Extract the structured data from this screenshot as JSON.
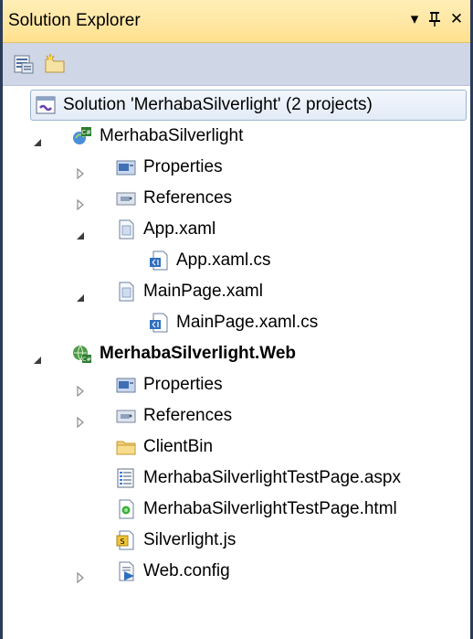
{
  "panel": {
    "title": "Solution Explorer",
    "controls": {
      "dropdown": "▾",
      "pin": "ᛘ",
      "close": "✕"
    }
  },
  "toolbar": {
    "buttons": [
      {
        "name": "properties-icon"
      },
      {
        "name": "show-all-files-icon"
      }
    ]
  },
  "tree": {
    "solution": "Solution 'MerhabaSilverlight' (2 projects)",
    "items": [
      {
        "label": "MerhabaSilverlight",
        "icon": "csharp-silverlight-project-icon",
        "expander": "expanded"
      },
      {
        "label": "Properties",
        "icon": "properties-folder-icon",
        "expander": "collapsed"
      },
      {
        "label": "References",
        "icon": "references-folder-icon",
        "expander": "collapsed"
      },
      {
        "label": "App.xaml",
        "icon": "xaml-file-icon",
        "expander": "expanded"
      },
      {
        "label": "App.xaml.cs",
        "icon": "code-file-icon",
        "expander": "none"
      },
      {
        "label": "MainPage.xaml",
        "icon": "xaml-file-icon",
        "expander": "expanded"
      },
      {
        "label": "MainPage.xaml.cs",
        "icon": "code-file-icon",
        "expander": "none"
      },
      {
        "label": "MerhabaSilverlight.Web",
        "icon": "csharp-web-project-icon",
        "expander": "expanded"
      },
      {
        "label": "Properties",
        "icon": "properties-folder-icon",
        "expander": "collapsed"
      },
      {
        "label": "References",
        "icon": "references-folder-icon",
        "expander": "collapsed"
      },
      {
        "label": "ClientBin",
        "icon": "folder-icon",
        "expander": "none"
      },
      {
        "label": "MerhabaSilverlightTestPage.aspx",
        "icon": "aspx-file-icon",
        "expander": "none"
      },
      {
        "label": "MerhabaSilverlightTestPage.html",
        "icon": "html-file-icon",
        "expander": "none"
      },
      {
        "label": "Silverlight.js",
        "icon": "js-file-icon",
        "expander": "none"
      },
      {
        "label": "Web.config",
        "icon": "config-file-icon",
        "expander": "collapsed"
      }
    ]
  },
  "colors": {
    "frame": "#2b3c59",
    "title_bar": "#ffe8a6",
    "toolbar": "#cfd6e5",
    "selection_border": "#99b4d1"
  }
}
